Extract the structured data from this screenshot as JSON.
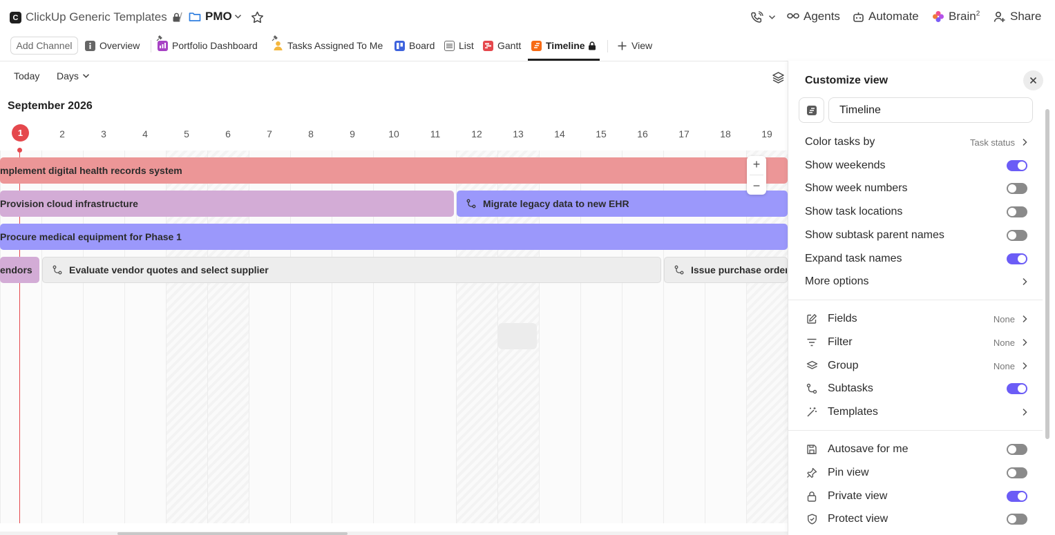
{
  "breadcrumb": {
    "workspace": "ClickUp Generic Templates",
    "workspace_logo": "C",
    "separator": "/",
    "space": "PMO"
  },
  "top_actions": {
    "agents": "Agents",
    "automate": "Automate",
    "brain": "Brain",
    "brain_sup": "2",
    "share": "Share"
  },
  "tabs": {
    "add_channel": "Add Channel",
    "items": [
      {
        "label": "Overview",
        "icon": "info-icon"
      },
      {
        "label": "Portfolio Dashboard",
        "icon": "dashboard-icon"
      },
      {
        "label": "Tasks Assigned To Me",
        "icon": "person-icon"
      },
      {
        "label": "Board",
        "icon": "board-icon"
      },
      {
        "label": "List",
        "icon": "list-icon"
      },
      {
        "label": "Gantt",
        "icon": "gantt-icon"
      },
      {
        "label": "Timeline",
        "icon": "timeline-icon",
        "active": true
      }
    ],
    "add_view": "View"
  },
  "toolbar": {
    "today": "Today",
    "scale": "Days"
  },
  "timeline": {
    "month": "September 2026",
    "days": [
      "1",
      "2",
      "3",
      "4",
      "5",
      "6",
      "7",
      "8",
      "9",
      "10",
      "11",
      "12",
      "13",
      "14",
      "15",
      "16",
      "17",
      "18",
      "19"
    ],
    "today": "1",
    "weekend_days": [
      "5",
      "6",
      "12",
      "13",
      "19"
    ],
    "tasks": [
      {
        "name": "mplement digital health records system",
        "color": "#ec9697"
      },
      {
        "name": "Provision cloud infrastructure",
        "color": "#d3acd6"
      },
      {
        "name": "Migrate legacy data to new EHR",
        "color": "#9b98fb",
        "subtask": true
      },
      {
        "name": "Procure medical equipment for Phase 1",
        "color": "#9b98fb"
      },
      {
        "name": "endors",
        "color": "#d3acd6"
      },
      {
        "name": "Evaluate vendor quotes and select supplier",
        "color": "#ededed",
        "subtask": true
      },
      {
        "name": "Issue purchase orders",
        "color": "#ededed",
        "subtask": true
      }
    ],
    "zoom_in": "+",
    "zoom_out": "−"
  },
  "panel": {
    "title": "Customize view",
    "view_name": "Timeline",
    "settings": [
      {
        "label": "Color tasks by",
        "value": "Task status",
        "type": "link"
      },
      {
        "label": "Show weekends",
        "type": "toggle",
        "on": true
      },
      {
        "label": "Show week numbers",
        "type": "toggle",
        "on": false
      },
      {
        "label": "Show task locations",
        "type": "toggle",
        "on": false
      },
      {
        "label": "Show subtask parent names",
        "type": "toggle",
        "on": false
      },
      {
        "label": "Expand task names",
        "type": "toggle",
        "on": true
      },
      {
        "label": "More options",
        "type": "link"
      }
    ],
    "fields_section": [
      {
        "label": "Fields",
        "value": "None",
        "icon": "edit-icon",
        "type": "link"
      },
      {
        "label": "Filter",
        "value": "None",
        "icon": "filter-icon",
        "type": "link"
      },
      {
        "label": "Group",
        "value": "None",
        "icon": "layers-icon",
        "type": "link"
      },
      {
        "label": "Subtasks",
        "icon": "subtask-icon",
        "type": "toggle",
        "on": true
      },
      {
        "label": "Templates",
        "icon": "magic-wand-icon",
        "type": "link"
      }
    ],
    "view_section": [
      {
        "label": "Autosave for me",
        "icon": "save-icon",
        "on": false
      },
      {
        "label": "Pin view",
        "icon": "pin-icon",
        "on": false
      },
      {
        "label": "Private view",
        "icon": "lock-icon",
        "on": true
      },
      {
        "label": "Protect view",
        "icon": "shield-icon",
        "on": false
      }
    ]
  },
  "colors": {
    "accent": "#6b5cf6",
    "today": "#e5484d"
  }
}
